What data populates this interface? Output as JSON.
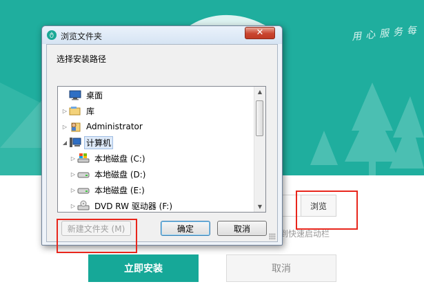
{
  "installer": {
    "slogan": "用心服务每",
    "browse_label": "浏览",
    "shortcut_text": "到快速启动栏",
    "install_label": "立即安装",
    "cancel_label": "取消",
    "accent_color": "#1fae9e"
  },
  "dialog": {
    "title": "浏览文件夹",
    "close_glyph": "✕",
    "prompt": "选择安装路径",
    "tree": [
      {
        "label": "桌面",
        "icon": "desktop-icon",
        "expander": ""
      },
      {
        "label": "库",
        "icon": "library-icon",
        "expander": "▷"
      },
      {
        "label": "Administrator",
        "icon": "user-folder-icon",
        "expander": "▷"
      },
      {
        "label": "计算机",
        "icon": "computer-icon",
        "expander": "◢",
        "selected": true
      },
      {
        "label": "本地磁盘 (C:)",
        "icon": "system-drive-icon",
        "expander": "▷"
      },
      {
        "label": "本地磁盘 (D:)",
        "icon": "drive-icon",
        "expander": "▷"
      },
      {
        "label": "本地磁盘 (E:)",
        "icon": "drive-icon",
        "expander": "▷"
      },
      {
        "label": "DVD RW 驱动器 (F:)",
        "icon": "dvd-drive-icon",
        "expander": "▷"
      }
    ],
    "new_folder_label": "新建文件夹 (M)",
    "ok_label": "确定",
    "cancel_label": "取消"
  }
}
